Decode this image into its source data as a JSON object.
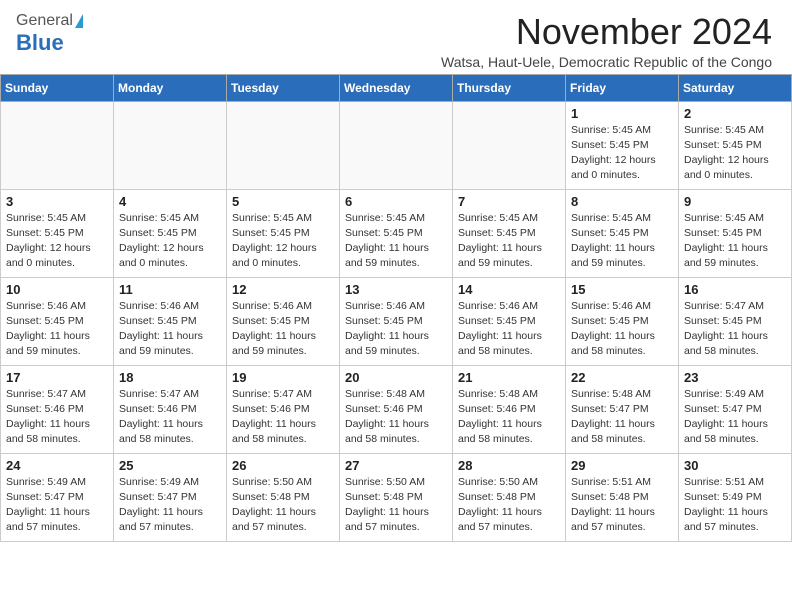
{
  "header": {
    "logo_general": "General",
    "logo_blue": "Blue",
    "month_title": "November 2024",
    "subtitle": "Watsa, Haut-Uele, Democratic Republic of the Congo"
  },
  "days_of_week": [
    "Sunday",
    "Monday",
    "Tuesday",
    "Wednesday",
    "Thursday",
    "Friday",
    "Saturday"
  ],
  "weeks": [
    [
      {
        "day": "",
        "info": ""
      },
      {
        "day": "",
        "info": ""
      },
      {
        "day": "",
        "info": ""
      },
      {
        "day": "",
        "info": ""
      },
      {
        "day": "",
        "info": ""
      },
      {
        "day": "1",
        "info": "Sunrise: 5:45 AM\nSunset: 5:45 PM\nDaylight: 12 hours\nand 0 minutes."
      },
      {
        "day": "2",
        "info": "Sunrise: 5:45 AM\nSunset: 5:45 PM\nDaylight: 12 hours\nand 0 minutes."
      }
    ],
    [
      {
        "day": "3",
        "info": "Sunrise: 5:45 AM\nSunset: 5:45 PM\nDaylight: 12 hours\nand 0 minutes."
      },
      {
        "day": "4",
        "info": "Sunrise: 5:45 AM\nSunset: 5:45 PM\nDaylight: 12 hours\nand 0 minutes."
      },
      {
        "day": "5",
        "info": "Sunrise: 5:45 AM\nSunset: 5:45 PM\nDaylight: 12 hours\nand 0 minutes."
      },
      {
        "day": "6",
        "info": "Sunrise: 5:45 AM\nSunset: 5:45 PM\nDaylight: 11 hours\nand 59 minutes."
      },
      {
        "day": "7",
        "info": "Sunrise: 5:45 AM\nSunset: 5:45 PM\nDaylight: 11 hours\nand 59 minutes."
      },
      {
        "day": "8",
        "info": "Sunrise: 5:45 AM\nSunset: 5:45 PM\nDaylight: 11 hours\nand 59 minutes."
      },
      {
        "day": "9",
        "info": "Sunrise: 5:45 AM\nSunset: 5:45 PM\nDaylight: 11 hours\nand 59 minutes."
      }
    ],
    [
      {
        "day": "10",
        "info": "Sunrise: 5:46 AM\nSunset: 5:45 PM\nDaylight: 11 hours\nand 59 minutes."
      },
      {
        "day": "11",
        "info": "Sunrise: 5:46 AM\nSunset: 5:45 PM\nDaylight: 11 hours\nand 59 minutes."
      },
      {
        "day": "12",
        "info": "Sunrise: 5:46 AM\nSunset: 5:45 PM\nDaylight: 11 hours\nand 59 minutes."
      },
      {
        "day": "13",
        "info": "Sunrise: 5:46 AM\nSunset: 5:45 PM\nDaylight: 11 hours\nand 59 minutes."
      },
      {
        "day": "14",
        "info": "Sunrise: 5:46 AM\nSunset: 5:45 PM\nDaylight: 11 hours\nand 58 minutes."
      },
      {
        "day": "15",
        "info": "Sunrise: 5:46 AM\nSunset: 5:45 PM\nDaylight: 11 hours\nand 58 minutes."
      },
      {
        "day": "16",
        "info": "Sunrise: 5:47 AM\nSunset: 5:45 PM\nDaylight: 11 hours\nand 58 minutes."
      }
    ],
    [
      {
        "day": "17",
        "info": "Sunrise: 5:47 AM\nSunset: 5:46 PM\nDaylight: 11 hours\nand 58 minutes."
      },
      {
        "day": "18",
        "info": "Sunrise: 5:47 AM\nSunset: 5:46 PM\nDaylight: 11 hours\nand 58 minutes."
      },
      {
        "day": "19",
        "info": "Sunrise: 5:47 AM\nSunset: 5:46 PM\nDaylight: 11 hours\nand 58 minutes."
      },
      {
        "day": "20",
        "info": "Sunrise: 5:48 AM\nSunset: 5:46 PM\nDaylight: 11 hours\nand 58 minutes."
      },
      {
        "day": "21",
        "info": "Sunrise: 5:48 AM\nSunset: 5:46 PM\nDaylight: 11 hours\nand 58 minutes."
      },
      {
        "day": "22",
        "info": "Sunrise: 5:48 AM\nSunset: 5:47 PM\nDaylight: 11 hours\nand 58 minutes."
      },
      {
        "day": "23",
        "info": "Sunrise: 5:49 AM\nSunset: 5:47 PM\nDaylight: 11 hours\nand 58 minutes."
      }
    ],
    [
      {
        "day": "24",
        "info": "Sunrise: 5:49 AM\nSunset: 5:47 PM\nDaylight: 11 hours\nand 57 minutes."
      },
      {
        "day": "25",
        "info": "Sunrise: 5:49 AM\nSunset: 5:47 PM\nDaylight: 11 hours\nand 57 minutes."
      },
      {
        "day": "26",
        "info": "Sunrise: 5:50 AM\nSunset: 5:48 PM\nDaylight: 11 hours\nand 57 minutes."
      },
      {
        "day": "27",
        "info": "Sunrise: 5:50 AM\nSunset: 5:48 PM\nDaylight: 11 hours\nand 57 minutes."
      },
      {
        "day": "28",
        "info": "Sunrise: 5:50 AM\nSunset: 5:48 PM\nDaylight: 11 hours\nand 57 minutes."
      },
      {
        "day": "29",
        "info": "Sunrise: 5:51 AM\nSunset: 5:48 PM\nDaylight: 11 hours\nand 57 minutes."
      },
      {
        "day": "30",
        "info": "Sunrise: 5:51 AM\nSunset: 5:49 PM\nDaylight: 11 hours\nand 57 minutes."
      }
    ]
  ]
}
